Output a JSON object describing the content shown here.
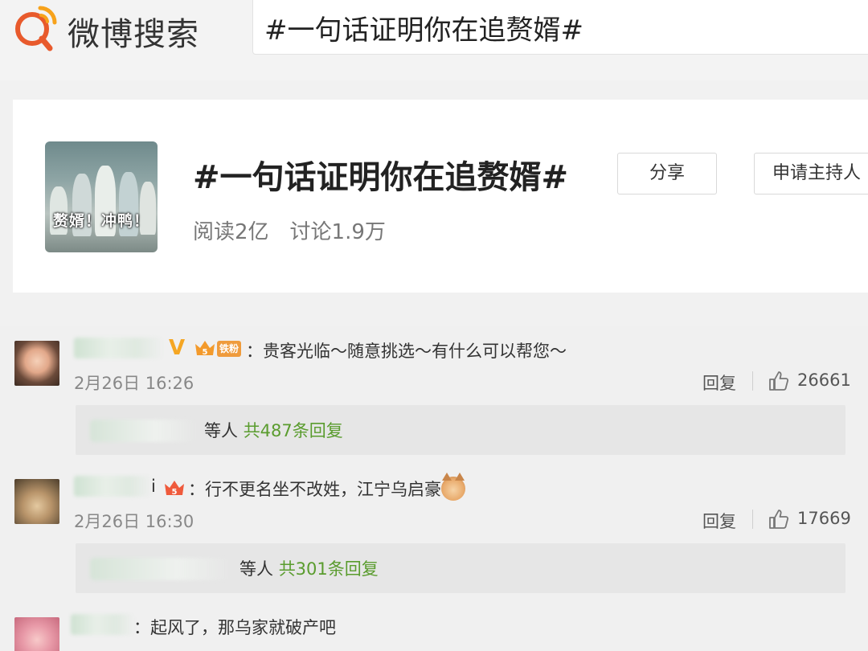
{
  "header": {
    "brand": "微博搜索",
    "search_value": "#一句话证明你在追赘婿#",
    "brand_color": "#e85a2c"
  },
  "topic": {
    "title": "#一句话证明你在追赘婿#",
    "thumb_caption": "赘婿！冲鸭！",
    "reads": "阅读2亿",
    "discussions": "讨论1.9万",
    "share_label": "分享",
    "host_label": "申请主持人"
  },
  "comments": [
    {
      "colon": "：",
      "text": "贵客光临～随意挑选～有什么可以帮您～",
      "fan_badge": "铁粉",
      "time": "2月26日 16:26",
      "reply_label": "回复",
      "likes": "26661",
      "reply_prefix": "等人",
      "reply_total": "共487条回复"
    },
    {
      "name_suffix": "i",
      "colon": "：",
      "text": "行不更名坐不改姓，江宁乌启豪",
      "time": "2月26日 16:30",
      "reply_label": "回复",
      "likes": "17669",
      "reply_prefix": "等人",
      "reply_total": "共301条回复"
    },
    {
      "colon": "：",
      "text": "起风了，那乌家就破产吧"
    }
  ],
  "icons": {
    "logo": "weibo-search-logo",
    "like": "thumbs-up-icon",
    "emoji": "cat-emoji",
    "verified": "v-badge"
  }
}
